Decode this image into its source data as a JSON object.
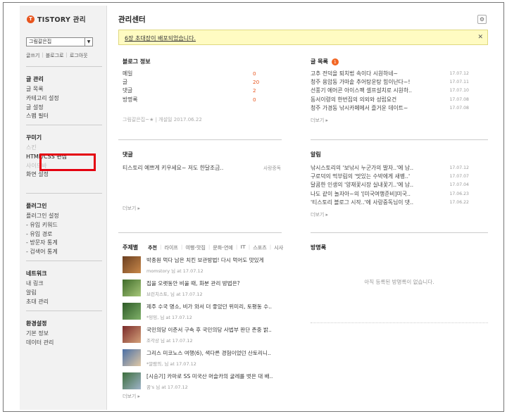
{
  "brand": {
    "logo_mark": "T",
    "name": "TISTORY 관리"
  },
  "sidebar": {
    "blog_select_value": "그림갈은집",
    "quick_links": [
      "글쓰기",
      "블로그로",
      "로그아웃"
    ],
    "groups": [
      {
        "title": "글 관리",
        "items": [
          "글 목록",
          "카테고리 설정",
          "글 설정",
          "스팸 필터"
        ]
      },
      {
        "title": "꾸미기",
        "items": [
          "스킨",
          "HTML/CSS 편집",
          "사이드바",
          "화면 설정"
        ]
      },
      {
        "title": "플러그인",
        "items": [
          "플러그인 설정",
          "- 유입 키워드",
          "- 유입 경로",
          "- 방문자 통계",
          "- 검색어 통계"
        ]
      },
      {
        "title": "네트워크",
        "items": [
          "내 링크",
          "알림",
          "초대 관리"
        ]
      },
      {
        "title": "환경설정",
        "items": [
          "기본 정보",
          "데이터 관리"
        ]
      }
    ]
  },
  "main": {
    "title": "관리센터",
    "notice": "6장 초대장이 배포되었습니다.",
    "blog_info": {
      "title": "블로그 정보",
      "stats": [
        {
          "label": "메일",
          "value": "0"
        },
        {
          "label": "글",
          "value": "20"
        },
        {
          "label": "댓글",
          "value": "2"
        },
        {
          "label": "방명록",
          "value": "0"
        }
      ],
      "meta": "그림갈은집~★ | 개설일 2017.06.22"
    },
    "posts": {
      "title": "글 목록",
      "badge": "1",
      "items": [
        {
          "text": "고추 전덕을 퇴치법 속이다 시원하네~",
          "date": "17.07.12"
        },
        {
          "text": "청주 용암동 가마솥 추어탕운탕 힘이난다~!",
          "date": "17.07.11"
        },
        {
          "text": "선풍기 에어콘 아이스팩 셀프설치로 시원하..",
          "date": "17.07.10"
        },
        {
          "text": "동서이령의 한번집의 의외와 성립요건",
          "date": "17.07.08"
        },
        {
          "text": "청주 가경동 낚시카페에서 즐거운 데이트~",
          "date": "17.07.08"
        }
      ],
      "more": "더보기"
    },
    "comments": {
      "title": "댓글",
      "items": [
        {
          "text": "티스토리 예쁘게 키우세요~ 저도 한달조금..",
          "who": "사랑중독"
        }
      ],
      "more": "더보기"
    },
    "alerts": {
      "title": "알림",
      "items": [
        {
          "text": "낚시스토리의 '보낚시 누군가의 발자..'에 남..",
          "date": "17.07.12"
        },
        {
          "text": "구로덕의 먹부림의 '맛있는 수박에게 새벵..'",
          "date": "17.07.07"
        },
        {
          "text": "달콤한 인생의 '양재꽃시장 실내꽃기..'에 남..",
          "date": "17.07.04"
        },
        {
          "text": "나도 같이 놀자아~의 '[미국여행준비]미국..",
          "date": "17.06.23"
        },
        {
          "text": "'티스토리 블로그 시작..'에 사랑중독님이 댓..",
          "date": "17.06.22"
        }
      ],
      "more": "더보기"
    },
    "subscriptions": {
      "title": "주제별",
      "tabs": [
        "추천",
        "라이프",
        "여행·맛집",
        "문화·연예",
        "IT",
        "스포츠",
        "시사"
      ],
      "items": [
        {
          "title": "박종원 먹다 남은 치킨 보관방법! 다시 먹어도 맛있게",
          "sub": "momstory 님 at 17.07.12"
        },
        {
          "title": "집을 오랫동안 비울 때, 화분 관리 방법은?",
          "sub": "브런치스토, 님 at 17.07.12"
        },
        {
          "title": "제주 수국 명소, 비가 와서 더 좋았던 위미리, 토평동 수..",
          "sub": "*밍밍, 님 at 17.07.12"
        },
        {
          "title": "국민의당 이준서 구속 후 국민의당 사법부 판단 존중 밝..",
          "sub": "조각상 님 at 17.07.12"
        },
        {
          "title": "그리스 미코노스 여행(6), 색다른 경험이었던 산토리니..",
          "sub": "*알람의, 님 at 17.07.12"
        },
        {
          "title": "[시승기] 카마로 SS 미국산 머슬카의 굴레를 벗은 대 배..",
          "sub": "꿈's 님 at 17.07.12"
        }
      ],
      "more": "더보기"
    },
    "guestbook": {
      "title": "방명록",
      "empty": "아직 등록된 방명록이 없습니다."
    }
  },
  "colors": {
    "accent": "#e8551e",
    "notice_bg": "#fffbc2",
    "highlight_box": "#e4000f"
  }
}
